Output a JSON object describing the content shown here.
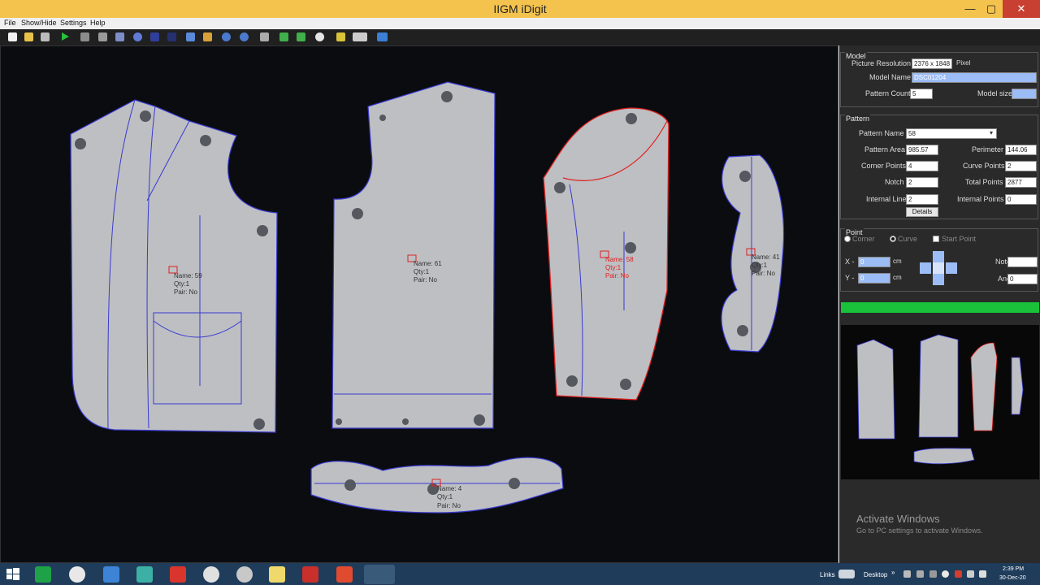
{
  "window": {
    "title": "IIGM iDigit",
    "minimize": "—",
    "maximize": "▢",
    "close": "✕"
  },
  "menu": [
    "File",
    "Show/Hide",
    "Settings",
    "Help"
  ],
  "canvas": {
    "pieces": [
      {
        "name": "Name: 59",
        "qty": "Qty:1",
        "pair": "Pair: No"
      },
      {
        "name": "Name: 61",
        "qty": "Qty:1",
        "pair": "Pair: No"
      },
      {
        "name": "Name: 58",
        "qty": "Qty:1",
        "pair": "Pair: No"
      },
      {
        "name": "Name: 41",
        "qty": "Qty:1",
        "pair": "Pair: No"
      },
      {
        "name": "Name: 4",
        "qty": "Qty:1",
        "pair": "Pair: No"
      }
    ]
  },
  "model": {
    "title": "Model",
    "resolution_label": "Picture Resolution",
    "resolution_value": "2376 x 1848",
    "resolution_unit": "Pixel",
    "name_label": "Model Name",
    "name_value": "DSC01204",
    "count_label": "Pattern Count",
    "count_value": "5",
    "size_label": "Model size",
    "size_value": ""
  },
  "pattern": {
    "title": "Pattern",
    "name_label": "Pattern Name",
    "name_value": "58",
    "area_label": "Pattern Area",
    "area_value": "985.57",
    "perimeter_label": "Perimeter",
    "perimeter_value": "144.06",
    "corner_label": "Corner Points",
    "corner_value": "4",
    "curve_label": "Curve Points",
    "curve_value": "2",
    "notch_label": "Notch",
    "notch_value": "2",
    "total_label": "Total Points",
    "total_value": "2877",
    "internal_line_label": "Internal Line",
    "internal_line_value": "2",
    "internal_points_label": "Internal Points",
    "internal_points_value": "0",
    "details_button": "Details"
  },
  "point": {
    "title": "Point",
    "corner_radio": "Corner",
    "curve_radio": "Curve",
    "start_check": "Start Point",
    "x_label": "X -",
    "x_value": "0",
    "x_unit": "cm",
    "y_label": "Y -",
    "y_value": "0",
    "y_unit": "cm",
    "notch_label": "Notch",
    "notch_value": "",
    "angle_label": "Angle",
    "angle_value": "0"
  },
  "progress": 1.0,
  "watermark": {
    "line1": "Activate Windows",
    "line2": "Go to PC settings to activate Windows."
  },
  "taskbar": {
    "links": "Links",
    "desktop": "Desktop",
    "time": "2:39 PM",
    "date": "30-Dec-20"
  },
  "colors": {
    "titlebar": "#f3c34e",
    "outline": "#3a3ad0",
    "highlight": "#e02020",
    "progress": "#19c23a",
    "selection": "#9bbcf5"
  }
}
